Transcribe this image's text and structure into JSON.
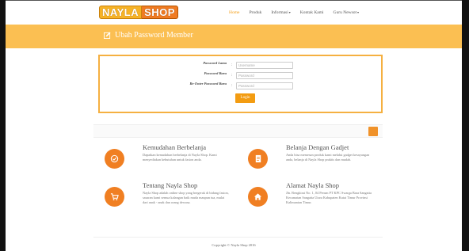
{
  "brand": {
    "word1": "NAYLA",
    "word2": "SHOP"
  },
  "nav": [
    {
      "label": "Home",
      "active": true,
      "dropdown": false
    },
    {
      "label": "Produk",
      "active": false,
      "dropdown": false
    },
    {
      "label": "Informasi",
      "active": false,
      "dropdown": true
    },
    {
      "label": "Kontak Kami",
      "active": false,
      "dropdown": false
    },
    {
      "label": "Guru Newsot",
      "active": false,
      "dropdown": true
    }
  ],
  "band": {
    "title": "Ubah Password Member"
  },
  "form": {
    "fields": [
      {
        "label": "Password Lama",
        "colon": ":",
        "placeholder": "Username"
      },
      {
        "label": "Password Baru",
        "colon": ":",
        "placeholder": "Password"
      },
      {
        "label": "Re-Enter Password Baru",
        "colon": ":",
        "placeholder": "Password"
      }
    ],
    "submit_label": "Login"
  },
  "features": [
    {
      "icon": "check-circle-icon",
      "title": "Kemudahan Berbelanja",
      "text": "Dapatkan kemudahan berbelanja di Nayla Shop. Kami menyediakan kebutuhan untuk fasion anda."
    },
    {
      "icon": "document-icon",
      "title": "Belanja Dengan Gadjet",
      "text": "Anda bisa memesan produk kami melalui gadget kesayangan anda, belanja di Nayla Shop praktis dan mudah."
    },
    {
      "icon": "cart-icon",
      "title": "Tentang Nayla Shop",
      "text": "Nayla Shop adalah online shop yang bergerak di bidang fasion, sasaran kami semua kalangan baik muda maupun tua, mulai dari anak - anak dan orang dewasa."
    },
    {
      "icon": "home-icon",
      "title": "Alamat Nayla Shop",
      "text": "Jln. Bengkirai No. 1, 04 Perum PT KPC Swarga Bara Sangatta Kecamatan Sangatta Utara Kabupaten Kutai Timur Provinsi Kalimantan Timur."
    }
  ],
  "footer": {
    "text": "Copyright © Nayla Shop 2016"
  },
  "colors": {
    "accent": "#f39c12",
    "band": "#fbbf52",
    "icon_bg": "#f07f22"
  }
}
